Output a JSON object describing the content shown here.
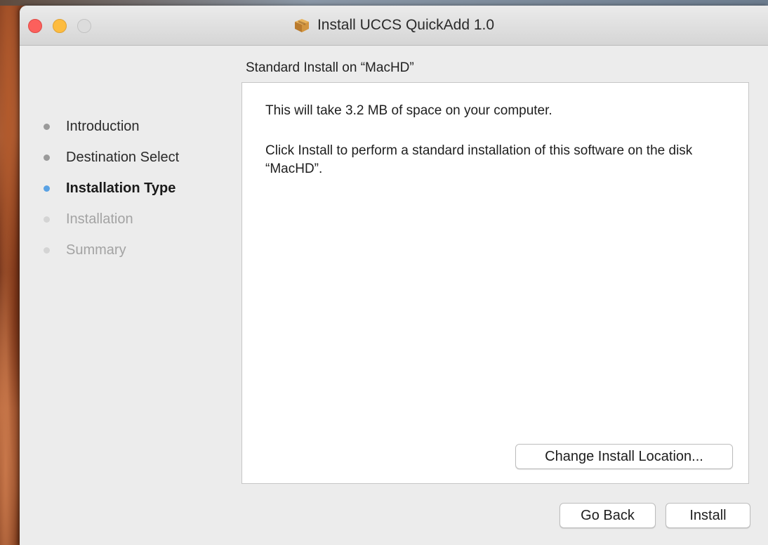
{
  "window": {
    "title": "Install UCCS QuickAdd 1.0",
    "title_icon": "package-icon"
  },
  "heading": "Standard Install on “MacHD”",
  "steps": [
    {
      "label": "Introduction",
      "state": "done"
    },
    {
      "label": "Destination Select",
      "state": "done"
    },
    {
      "label": "Installation Type",
      "state": "current"
    },
    {
      "label": "Installation",
      "state": "pending"
    },
    {
      "label": "Summary",
      "state": "pending"
    }
  ],
  "content": {
    "line1": "This will take 3.2 MB of space on your computer.",
    "line2": "Click Install to perform a standard installation of this software on the disk “MacHD”.",
    "change_location_label": "Change Install Location..."
  },
  "buttons": {
    "go_back": "Go Back",
    "install": "Install"
  },
  "colors": {
    "close": "#fc605c",
    "minimize": "#fdbc40",
    "zoom": "#dcdcdc",
    "current_step": "#5aa2e4"
  }
}
